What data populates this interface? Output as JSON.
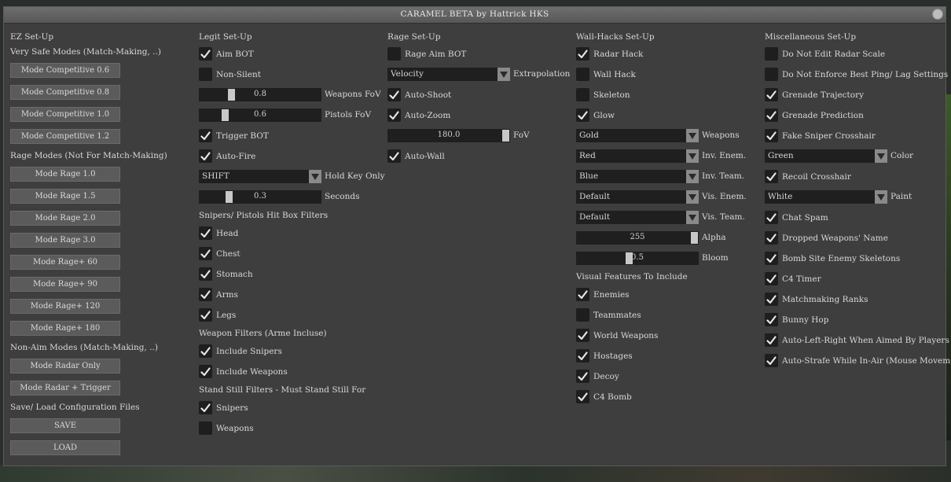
{
  "window": {
    "title": "CARAMEL BETA by Hattrick HKS"
  },
  "col1": {
    "header": "EZ Set-Up",
    "very_safe_label": "Very Safe Modes (Match-Making, ..)",
    "competitive": [
      "Mode Competitive 0.6",
      "Mode Competitive 0.8",
      "Mode Competitive 1.0",
      "Mode Competitive 1.2"
    ],
    "rage_label": "Rage Modes (Not For Match-Making)",
    "rage": [
      "Mode Rage 1.0",
      "Mode Rage 1.5",
      "Mode Rage 2.0",
      "Mode Rage 3.0",
      "Mode Rage+ 60",
      "Mode Rage+ 90",
      "Mode Rage+ 120",
      "Mode Rage+ 180"
    ],
    "nonaim_label": "Non-Aim Modes (Match-Making, ..)",
    "nonaim": [
      "Mode Radar Only",
      "Mode Radar + Trigger"
    ],
    "config_label": "Save/ Load Configuration Files",
    "save": "SAVE",
    "load": "LOAD"
  },
  "col2": {
    "header": "Legit Set-Up",
    "aimbot": {
      "label": "Aim BOT",
      "checked": true
    },
    "nonsilent": {
      "label": "Non-Silent",
      "checked": false
    },
    "weapons_fov": {
      "value": "0.8",
      "label": "Weapons FoV",
      "level": 0.25
    },
    "pistols_fov": {
      "value": "0.6",
      "label": "Pistols FoV",
      "level": 0.19
    },
    "triggerbot": {
      "label": "Trigger BOT",
      "checked": true
    },
    "autofire": {
      "label": "Auto-Fire",
      "checked": true
    },
    "holdkey": {
      "value": "SHIFT",
      "label": "Hold Key Only"
    },
    "seconds": {
      "value": "0.3",
      "label": "Seconds",
      "level": 0.23
    },
    "hitbox_label": "Snipers/ Pistols Hit Box Filters",
    "hitbox": [
      {
        "label": "Head",
        "checked": true
      },
      {
        "label": "Chest",
        "checked": true
      },
      {
        "label": "Stomach",
        "checked": true
      },
      {
        "label": "Arms",
        "checked": true
      },
      {
        "label": "Legs",
        "checked": true
      }
    ],
    "weapon_filters_label": "Weapon Filters (Arme Incluse)",
    "include_snipers": {
      "label": "Include Snipers",
      "checked": true
    },
    "include_weapons": {
      "label": "Include Weapons",
      "checked": true
    },
    "standstill_label": "Stand Still Filters - Must Stand Still For",
    "ss_snipers": {
      "label": "Snipers",
      "checked": true
    },
    "ss_weapons": {
      "label": "Weapons",
      "checked": false
    }
  },
  "col3": {
    "header": "Rage Set-Up",
    "rage_aimbot": {
      "label": "Rage Aim BOT",
      "checked": false
    },
    "extrapolation": {
      "value": "Velocity",
      "label": "Extrapolation"
    },
    "autoshoot": {
      "label": "Auto-Shoot",
      "checked": true
    },
    "autozoom": {
      "label": "Auto-Zoom",
      "checked": true
    },
    "fov": {
      "value": "180.0",
      "label": "FoV",
      "level": 1.0
    },
    "autowall": {
      "label": "Auto-Wall",
      "checked": true
    }
  },
  "col4": {
    "header": "Wall-Hacks Set-Up",
    "radarhack": {
      "label": "Radar Hack",
      "checked": true
    },
    "wallhack": {
      "label": "Wall Hack",
      "checked": false
    },
    "skeleton": {
      "label": "Skeleton",
      "checked": false
    },
    "glow": {
      "label": "Glow",
      "checked": true
    },
    "combos": [
      {
        "value": "Gold",
        "label": "Weapons"
      },
      {
        "value": "Red",
        "label": "Inv. Enem."
      },
      {
        "value": "Blue",
        "label": "Inv. Team."
      },
      {
        "value": "Default",
        "label": "Vis. Enem."
      },
      {
        "value": "Default",
        "label": "Vis. Team."
      }
    ],
    "alpha": {
      "value": "255",
      "label": "Alpha",
      "level": 1.0
    },
    "bloom": {
      "value": "0.5",
      "label": "Bloom",
      "level": 0.43
    },
    "visual_label": "Visual Features To Include",
    "visual": [
      {
        "label": "Enemies",
        "checked": true
      },
      {
        "label": "Teammates",
        "checked": false
      },
      {
        "label": "World Weapons",
        "checked": true
      },
      {
        "label": "Hostages",
        "checked": true
      },
      {
        "label": "Decoy",
        "checked": true
      },
      {
        "label": "C4 Bomb",
        "checked": true
      }
    ]
  },
  "col5": {
    "header": "Miscellaneous Set-Up",
    "radar_scale": {
      "label": "Do Not Edit Radar Scale",
      "checked": false
    },
    "best_ping": {
      "label": "Do Not Enforce Best Ping/ Lag Settings",
      "checked": false
    },
    "grenade_traj": {
      "label": "Grenade Trajectory",
      "checked": true
    },
    "grenade_pred": {
      "label": "Grenade Prediction",
      "checked": true
    },
    "fake_sniper": {
      "label": "Fake Sniper Crosshair",
      "checked": true
    },
    "color": {
      "value": "Green",
      "label": "Color"
    },
    "recoil": {
      "label": "Recoil Crosshair",
      "checked": true
    },
    "paint": {
      "value": "White",
      "label": "Paint"
    },
    "rest": [
      {
        "label": "Chat Spam",
        "checked": true
      },
      {
        "label": "Dropped Weapons' Name",
        "checked": true
      },
      {
        "label": "Bomb Site Enemy Skeletons",
        "checked": true
      },
      {
        "label": "C4 Timer",
        "checked": true
      },
      {
        "label": "Matchmaking Ranks",
        "checked": true
      },
      {
        "label": "Bunny Hop",
        "checked": true
      },
      {
        "label": "Auto-Left-Right When Aimed By Players",
        "checked": true
      },
      {
        "label": "Auto-Strafe While In-Air (Mouse Movement)",
        "checked": true
      }
    ]
  }
}
